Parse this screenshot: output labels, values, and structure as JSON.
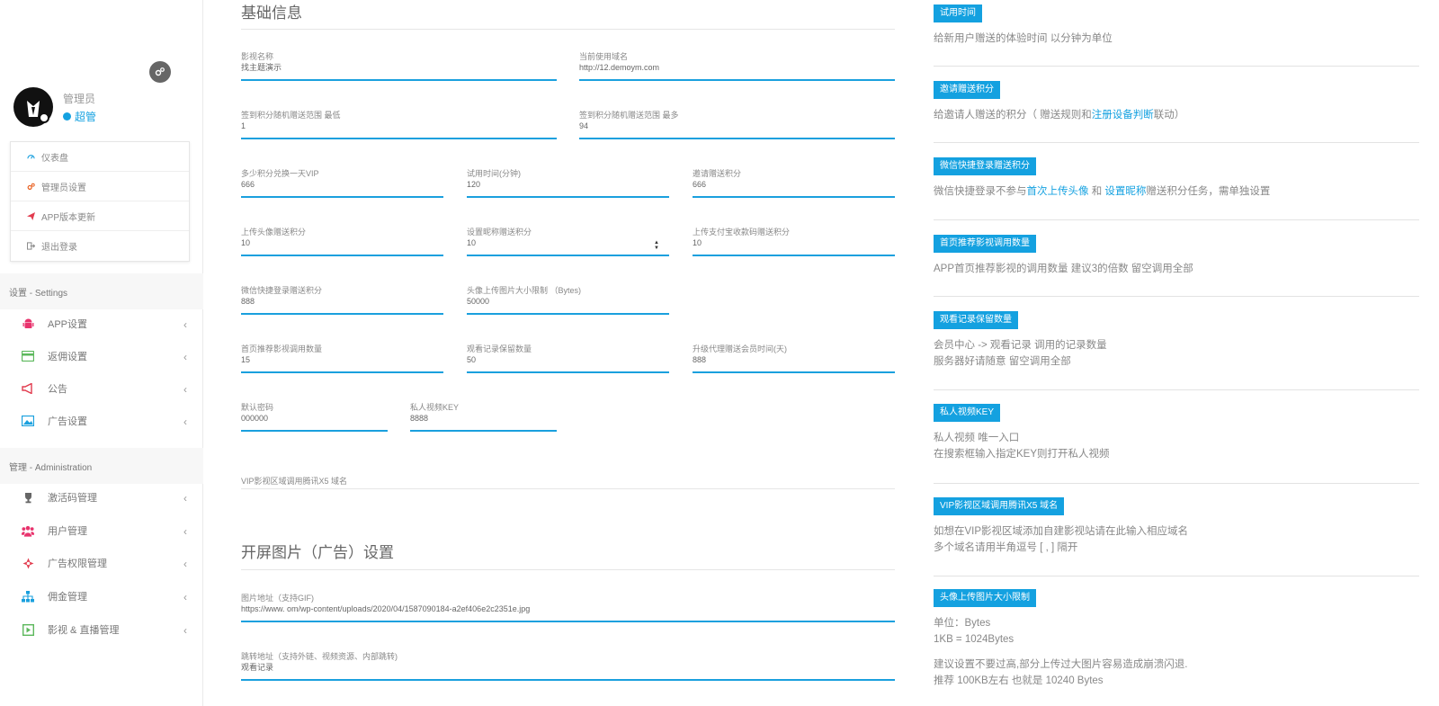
{
  "sidebar": {
    "profile": {
      "name": "管理员",
      "role": "超管"
    },
    "user_menu": [
      {
        "label": "仪表盘",
        "icon": "dashboard-icon",
        "color": "#1aa0de"
      },
      {
        "label": "管理员设置",
        "icon": "gears-icon",
        "color": "#e85a17"
      },
      {
        "label": "APP版本更新",
        "icon": "paper-plane-icon",
        "color": "#e23b4e"
      },
      {
        "label": "退出登录",
        "icon": "sign-out-icon",
        "color": "#888888"
      }
    ],
    "sections": [
      {
        "title": "设置 - Settings"
      },
      {
        "title": "管理 - Administration"
      }
    ],
    "settings_items": [
      {
        "label": "APP设置",
        "icon": "android-icon",
        "color": "#e8336d"
      },
      {
        "label": "返佣设置",
        "icon": "credit-card-icon",
        "color": "#5cb85c"
      },
      {
        "label": "公告",
        "icon": "bullhorn-icon",
        "color": "#e23b4e"
      },
      {
        "label": "广告设置",
        "icon": "picture-icon",
        "color": "#1aa0de"
      }
    ],
    "admin_items": [
      {
        "label": "激活码管理",
        "icon": "trophy-icon",
        "color": "#666666"
      },
      {
        "label": "用户管理",
        "icon": "users-icon",
        "color": "#e8336d"
      },
      {
        "label": "广告权限管理",
        "icon": "ad-permission-icon",
        "color": "#e23b4e"
      },
      {
        "label": "佣金管理",
        "icon": "sitemap-icon",
        "color": "#1aa0de"
      },
      {
        "label": "影视 & 直播管理",
        "icon": "play-square-icon",
        "color": "#5cb85c"
      }
    ]
  },
  "main": {
    "basic_title": "基础信息",
    "splash_title": "开屏图片（广告）设置",
    "fields": {
      "site_name": {
        "label": "影视名称",
        "value": "找主题演示"
      },
      "current_domain": {
        "label": "当前使用域名",
        "value": "http://12.demoym.com"
      },
      "checkin_min": {
        "label": "签到积分随机赠送范围 最低",
        "value": "1"
      },
      "checkin_max": {
        "label": "签到积分随机赠送范围 最多",
        "value": "94"
      },
      "points_per_vip_day": {
        "label": "多少积分兑换一天VIP",
        "value": "666"
      },
      "trial_minutes": {
        "label": "试用时间(分钟)",
        "value": "120"
      },
      "invite_points": {
        "label": "邀请赠送积分",
        "value": "666"
      },
      "avatar_points": {
        "label": "上传头像赠送积分",
        "value": "10"
      },
      "nickname_points": {
        "label": "设置昵称赠送积分",
        "value": "10"
      },
      "alipay_points": {
        "label": "上传支付宝收款码赠送积分",
        "value": "10"
      },
      "wechat_points": {
        "label": "微信快捷登录赠送积分",
        "value": "888"
      },
      "avatar_size": {
        "label": "头像上传图片大小限制 （Bytes)",
        "value": "50000"
      },
      "home_recommend": {
        "label": "首页推荐影视调用数量",
        "value": "15"
      },
      "history_count": {
        "label": "观看记录保留数量",
        "value": "50"
      },
      "agent_days": {
        "label": "升级代理赠送会员时间(天)",
        "value": "888"
      },
      "default_password": {
        "label": "默认密码",
        "value": "000000"
      },
      "private_key": {
        "label": "私人视频KEY",
        "value": "8888"
      },
      "vip_x5_domain": {
        "label": "VIP影视区域调用腾讯X5 域名",
        "value": ""
      },
      "splash_image": {
        "label": "图片地址（支持GIF)",
        "value": "https://www.            om/wp-content/uploads/2020/04/1587090184-a2ef406e2c2351e.jpg"
      },
      "splash_link": {
        "label": "跳转地址（支持外链、视频资源、内部跳转)",
        "value": "观看记录"
      }
    }
  },
  "help": [
    {
      "tag": "试用时间",
      "lines": [
        "给新用户赠送的体验时间 以分钟为单位"
      ]
    },
    {
      "tag": "邀请赠送积分",
      "pre": "给邀请人赠送的积分（ 赠送规则和",
      "link": "注册设备判断",
      "post": "联动）"
    },
    {
      "tag": "微信快捷登录赠送积分",
      "pre": "微信快捷登录不参与",
      "link": "首次上传头像",
      "mid": " 和 ",
      "link2": "设置昵称",
      "post": "赠送积分任务，需单独设置"
    },
    {
      "tag": "首页推荐影视调用数量",
      "lines": [
        "APP首页推荐影视的调用数量 建议3的倍数 留空调用全部"
      ]
    },
    {
      "tag": "观看记录保留数量",
      "lines": [
        "会员中心 -> 观看记录 调用的记录数量",
        "服务器好请随意 留空调用全部"
      ]
    },
    {
      "tag": "私人视频KEY",
      "lines": [
        "私人视频 唯一入口",
        "在搜索框输入指定KEY则打开私人视频"
      ]
    },
    {
      "tag": "VIP影视区域调用腾讯X5 域名",
      "lines": [
        "如想在VIP影视区域添加自建影视站请在此输入相应域名",
        "多个域名请用半角逗号 [ , ] 隔开"
      ]
    },
    {
      "tag": "头像上传图片大小限制",
      "lines": [
        "单位：Bytes",
        "1KB = 1024Bytes",
        "",
        "建议设置不要过高,部分上传过大图片容易造成崩溃闪退.",
        "推荐 100KB左右 也就是 10240 Bytes"
      ]
    }
  ]
}
